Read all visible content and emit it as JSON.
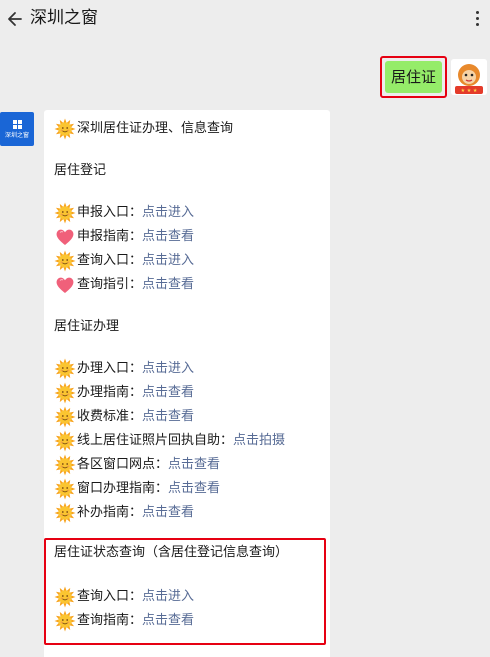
{
  "header": {
    "title": "深圳之窗"
  },
  "user_message": {
    "text": "居住证"
  },
  "account": {
    "avatar_label": "深圳之窗"
  },
  "card": {
    "intro": "深圳居住证办理、信息查询",
    "section1": {
      "heading": "居住登记",
      "items": [
        {
          "icon": "sun",
          "label": "申报入口：",
          "link": "点击进入"
        },
        {
          "icon": "heart",
          "label": "申报指南：",
          "link": "点击查看"
        },
        {
          "icon": "sun",
          "label": "查询入口：",
          "link": "点击进入"
        },
        {
          "icon": "heart",
          "label": "查询指引：",
          "link": "点击查看"
        }
      ]
    },
    "section2": {
      "heading": "居住证办理",
      "items": [
        {
          "icon": "sun",
          "label": "办理入口：",
          "link": "点击进入"
        },
        {
          "icon": "sun",
          "label": "办理指南：",
          "link": "点击查看"
        },
        {
          "icon": "sun",
          "label": "收费标准：",
          "link": "点击查看"
        },
        {
          "icon": "sun",
          "label": "线上居住证照片回执自助：",
          "link": "点击拍摄"
        },
        {
          "icon": "sun",
          "label": "各区窗口网点：",
          "link": "点击查看"
        },
        {
          "icon": "sun",
          "label": "窗口办理指南：",
          "link": "点击查看"
        },
        {
          "icon": "sun",
          "label": "补办指南：",
          "link": "点击查看"
        }
      ]
    },
    "section3": {
      "heading": "居住证状态查询（含居住登记信息查询）",
      "items": [
        {
          "icon": "sun",
          "label": "查询入口：",
          "link": "点击进入"
        },
        {
          "icon": "sun",
          "label": "查询指南：",
          "link": "点击查看"
        }
      ]
    }
  },
  "colors": {
    "link": "#576b95",
    "bubble": "#95ec69",
    "highlight": "#e60012",
    "avatar": "#1a66d6"
  },
  "icons": [
    "back-arrow-icon",
    "more-icon",
    "sun-emoji-icon",
    "heart-emoji-icon"
  ]
}
